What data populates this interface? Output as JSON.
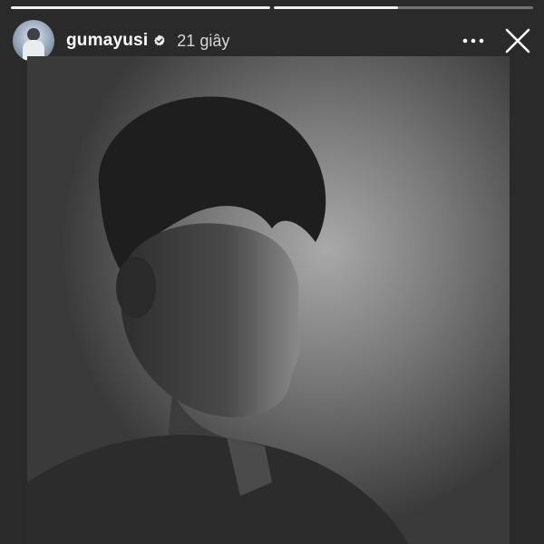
{
  "story": {
    "progress": [
      1.0,
      0.48
    ],
    "user": {
      "username": "gumayusi",
      "verified": true,
      "timestamp": "21 giây"
    },
    "icons": {
      "verified": "verified-badge-icon",
      "more": "more-options-icon",
      "close": "close-icon"
    },
    "photo": {
      "description_icon": "portrait-photo"
    }
  },
  "colors": {
    "background": "#2a2a2a",
    "text": "#ffffff",
    "muted_text": "#d6d6d6"
  }
}
